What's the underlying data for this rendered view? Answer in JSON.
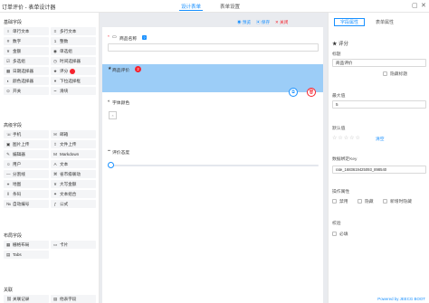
{
  "header": {
    "title": "订单评价 - 表单设计器",
    "tabs": [
      {
        "label": "设计表单",
        "active": true
      },
      {
        "label": "表单设置",
        "active": false
      }
    ]
  },
  "left_panel": {
    "groups": [
      {
        "title": "基础字段",
        "widgets": [
          {
            "label": "单行文本",
            "icon": "text-icon",
            "glyph": "I"
          },
          {
            "label": "多行文本",
            "icon": "textarea-icon",
            "glyph": "≡"
          },
          {
            "label": "数字",
            "icon": "number-icon",
            "glyph": "#"
          },
          {
            "label": "整数",
            "icon": "integer-icon",
            "glyph": "1"
          },
          {
            "label": "金额",
            "icon": "money-icon",
            "glyph": "¥"
          },
          {
            "label": "单选组",
            "icon": "radio-icon",
            "glyph": "◉"
          },
          {
            "label": "多选组",
            "icon": "checkbox-icon",
            "glyph": "☑"
          },
          {
            "label": "时间选择器",
            "icon": "time-icon",
            "glyph": "◷"
          },
          {
            "label": "日期选择器",
            "icon": "date-icon",
            "glyph": "▦"
          },
          {
            "label": "评分",
            "icon": "star-icon",
            "glyph": "★",
            "badge": true
          },
          {
            "label": "颜色选择器",
            "icon": "color-icon",
            "glyph": "◐"
          },
          {
            "label": "下拉选择框",
            "icon": "select-icon",
            "glyph": "▾"
          },
          {
            "label": "开关",
            "icon": "switch-icon",
            "glyph": "⊙"
          },
          {
            "label": "滑块",
            "icon": "slider-icon",
            "glyph": "┅"
          }
        ]
      },
      {
        "title": "高级字段",
        "widgets": [
          {
            "label": "手机",
            "icon": "phone-icon",
            "glyph": "☏"
          },
          {
            "label": "邮箱",
            "icon": "email-icon",
            "glyph": "✉"
          },
          {
            "label": "图片上传",
            "icon": "image-upload-icon",
            "glyph": "▣"
          },
          {
            "label": "文件上传",
            "icon": "file-upload-icon",
            "glyph": "⇪"
          },
          {
            "label": "编辑器",
            "icon": "editor-icon",
            "glyph": "✎"
          },
          {
            "label": "Markdown",
            "icon": "markdown-icon",
            "glyph": "M"
          },
          {
            "label": "用户",
            "icon": "user-icon",
            "glyph": "☺"
          },
          {
            "label": "文本",
            "icon": "text-a-icon",
            "glyph": "A"
          },
          {
            "label": "分割线",
            "icon": "divider-icon",
            "glyph": "—"
          },
          {
            "label": "省市级联动",
            "icon": "cascade-icon",
            "glyph": "⌘"
          },
          {
            "label": "地图",
            "icon": "map-icon",
            "glyph": "⌖"
          },
          {
            "label": "大写金额",
            "icon": "uppercase-money-icon",
            "glyph": "¥"
          },
          {
            "label": "条码",
            "icon": "barcode-icon",
            "glyph": "‖"
          },
          {
            "label": "文本组合",
            "icon": "text-group-icon",
            "glyph": "✦"
          },
          {
            "label": "自动编号",
            "icon": "auto-number-icon",
            "glyph": "№"
          },
          {
            "label": "公式",
            "icon": "formula-icon",
            "glyph": "ƒ"
          }
        ]
      },
      {
        "title": "布局字段",
        "widgets": [
          {
            "label": "栅格布局",
            "icon": "grid-icon",
            "glyph": "▦"
          },
          {
            "label": "卡片",
            "icon": "card-icon",
            "glyph": "▭"
          },
          {
            "label": "Tabs",
            "icon": "tabs-icon",
            "glyph": "▤"
          }
        ]
      },
      {
        "title": "关联",
        "widgets": [
          {
            "label": "关联记录",
            "icon": "link-record-icon",
            "glyph": "⛓"
          },
          {
            "label": "他表字段",
            "icon": "other-table-icon",
            "glyph": "▤"
          }
        ]
      }
    ]
  },
  "toolbar": {
    "preview": "预览",
    "save": "保存",
    "close": "关闭"
  },
  "canvas": {
    "fields": [
      {
        "label": "商品名称",
        "type": "input",
        "required": true
      },
      {
        "label": "商品评价",
        "type": "rate",
        "selected": true,
        "badge": "2"
      },
      {
        "label": "字体颜色",
        "type": "color"
      },
      {
        "label": "评价态度",
        "type": "slider"
      }
    ]
  },
  "right_panel": {
    "tabs": [
      {
        "label": "字段属性",
        "active": true
      },
      {
        "label": "表单属性",
        "active": false
      }
    ],
    "section_title": "评分",
    "title_label": "标题",
    "title_value": "商品评价",
    "hide_title": "隐藏标题",
    "max_label": "最大值",
    "max_value": "5",
    "default_label": "默认值",
    "clear_label": "清空",
    "bind_key_label": "数据绑定Key",
    "bind_key_value": "rate_1683619425093_898540",
    "attr_label": "操作属性",
    "attr_options": [
      "禁用",
      "隐藏",
      "新增时隐藏"
    ],
    "validate_label": "校验",
    "required_label": "必填",
    "powered_by": "Powered by JEECG BOOT",
    "accent": "#1890ff"
  }
}
